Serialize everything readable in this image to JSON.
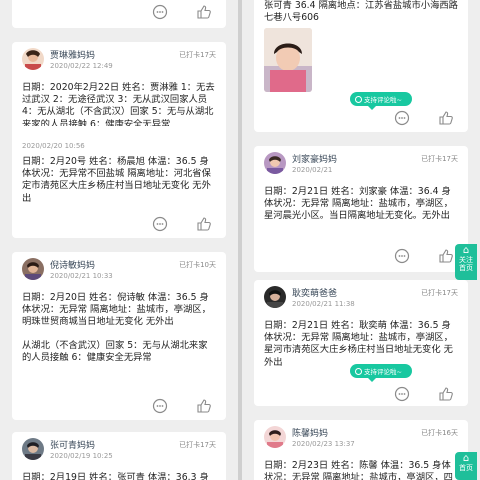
{
  "left": {
    "top_card": {},
    "card1": {
      "name": "贾琳雅妈妈",
      "date": "2020/02/22 12:49",
      "badge": "已打卡17天",
      "body": "日期：2020年2月22日 姓名：贾淋雅 1：无去过武汉 2：无途径武汉 3：无从武汉回家人员 4：无从湖北（不含武汉）回家 5：无与从湖北来家的人员接触 6：健康安全无异常"
    },
    "card2": {
      "date": "2020/02/20 10:56",
      "body": "日期：2月20号 姓名：杨晨旭 体温：36.5 身体状况：无异常不回盐城 隔离地址：河北省保定市清苑区大庄乡杨庄村当日地址无变化 无外出"
    },
    "card3": {
      "name": "倪诗敏妈妈",
      "date": "2020/02/21 10:33",
      "badge": "已打卡10天",
      "body": "日期：2月20日 姓名：倪诗敏 体温：36.5 身体状况：无异常 隔离地址：盐城市，亭湖区，明珠世贸商城当日地址无变化 无外出"
    },
    "card4": {
      "body": "从湖北（不含武汉）回家 5：无与从湖北来家的人员接触 6：健康安全无异常"
    },
    "card5": {
      "name": "张可青妈妈",
      "date": "2020/02/19 10:25",
      "badge": "已打卡17天",
      "body": "日期：2月19日 姓名：张可青 体温：36.3 身体状"
    }
  },
  "right": {
    "card1": {
      "body": "张可青 36.4 隔离地点：江苏省盐城市小海西路七巷八号606",
      "pill": "支持评论啦~"
    },
    "card2": {
      "name": "刘家豪妈妈",
      "date": "2020/02/21",
      "badge": "已打卡17天",
      "body": "日期：2月21日 姓名：刘家豪 体温：36.4 身体状况：无异常 隔离地址：盐城市，亭湖区，星河晨光小区。当日隔离地址无变化。无外出"
    },
    "card3": {
      "name": "耿奕萌爸爸",
      "date": "2020/02/21 11:38",
      "badge": "已打卡17天",
      "body": "日期：2月21日 姓名：耿奕萌 体温：36.5 身体状况：无异常 隔离地址：盐城市，亭湖区，星河市清苑区大庄乡杨庄村当日地址无变化 无外出",
      "pill": "支持评论啦~"
    },
    "card4": {
      "name": "陈馨妈妈",
      "date": "2020/02/23 13:37",
      "badge": "已打卡16天",
      "body": "日期：2月23日 姓名：陈馨 体温：36.5 身体状况：无异常 隔离地址：盐城市，亭湖区，四季新"
    }
  },
  "side_tab_top": {
    "line1": "关注",
    "line2": "首页"
  },
  "side_tab_bottom": {
    "line1": "首页"
  },
  "colors": {
    "accent": "#18c8a0",
    "text": "#222222",
    "muted": "#999999"
  }
}
